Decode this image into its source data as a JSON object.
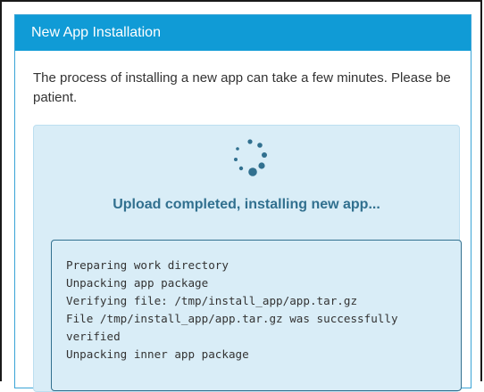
{
  "dialog": {
    "title": "New App Installation",
    "intro": "The process of installing a new app can take a few minutes. Please be patient."
  },
  "status": {
    "spinner_icon": "loading-spinner-icon",
    "message": "Upload completed, installing new app...",
    "colors": {
      "header": "#109bd6",
      "info_bg": "#d9edf7",
      "info_text": "#31708f"
    }
  },
  "log": {
    "lines": [
      "Preparing work directory",
      "Unpacking app package",
      "Verifying file: /tmp/install_app/app.tar.gz",
      "File /tmp/install_app/app.tar.gz was successfully verified",
      "Unpacking inner app package"
    ]
  }
}
